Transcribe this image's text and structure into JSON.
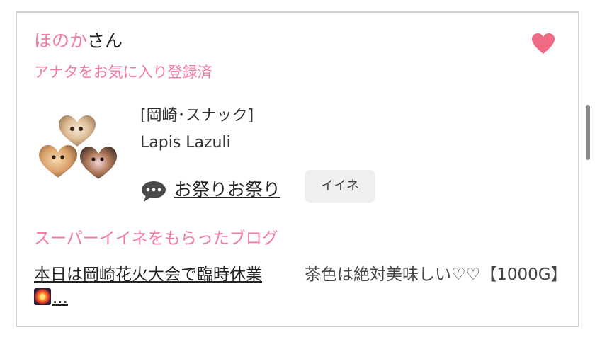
{
  "user": {
    "name": "ほのか",
    "suffix": "さん",
    "favorite_note": "アナタをお気に入り登録済"
  },
  "shop": {
    "category": "[岡崎･スナック]",
    "name": "Lapis Lazuli"
  },
  "post": {
    "title": "お祭りお祭り",
    "iine_label": "イイネ"
  },
  "blog": {
    "heading": "スーパーイイネをもらったブログ",
    "items": [
      {
        "title": "本日は岡崎花火大会で臨時休業",
        "ellipsis": "..."
      },
      {
        "title": "茶色は絶対美味しい♡♡【1000G】"
      }
    ]
  },
  "colors": {
    "accent_pink": "#f47aa0",
    "heart": "#f06a85"
  },
  "icons": {
    "favorite": "heart-icon",
    "comment": "speech-bubble-icon",
    "firework": "firework-emoji-icon"
  }
}
